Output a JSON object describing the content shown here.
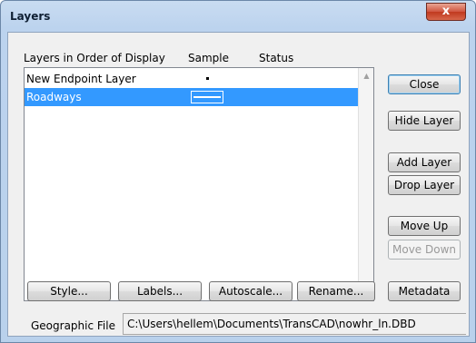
{
  "window": {
    "title": "Layers",
    "close_glyph": "x"
  },
  "list": {
    "headers": {
      "layers": "Layers in Order of Display",
      "sample": "Sample",
      "status": "Status"
    },
    "items": [
      {
        "name": "New Endpoint Layer",
        "sample": "point",
        "selected": false
      },
      {
        "name": "Roadways",
        "sample": "line",
        "selected": true
      }
    ],
    "scroll_up_icon": "triangle-up-icon",
    "scroll_down_icon": "triangle-down-icon"
  },
  "buttons": {
    "close": "Close",
    "hide_layer": "Hide Layer",
    "add_layer": "Add Layer",
    "drop_layer": "Drop Layer",
    "move_up": "Move Up",
    "move_down": "Move Down",
    "style": "Style...",
    "labels": "Labels...",
    "autoscale": "Autoscale...",
    "rename": "Rename...",
    "metadata": "Metadata"
  },
  "geographic_file": {
    "label": "Geographic File",
    "path": "C:\\Users\\hellem\\Documents\\TransCAD\\nowhr_ln.DBD"
  },
  "colors": {
    "selection": "#3399ff",
    "close_button": "#c7422a"
  }
}
